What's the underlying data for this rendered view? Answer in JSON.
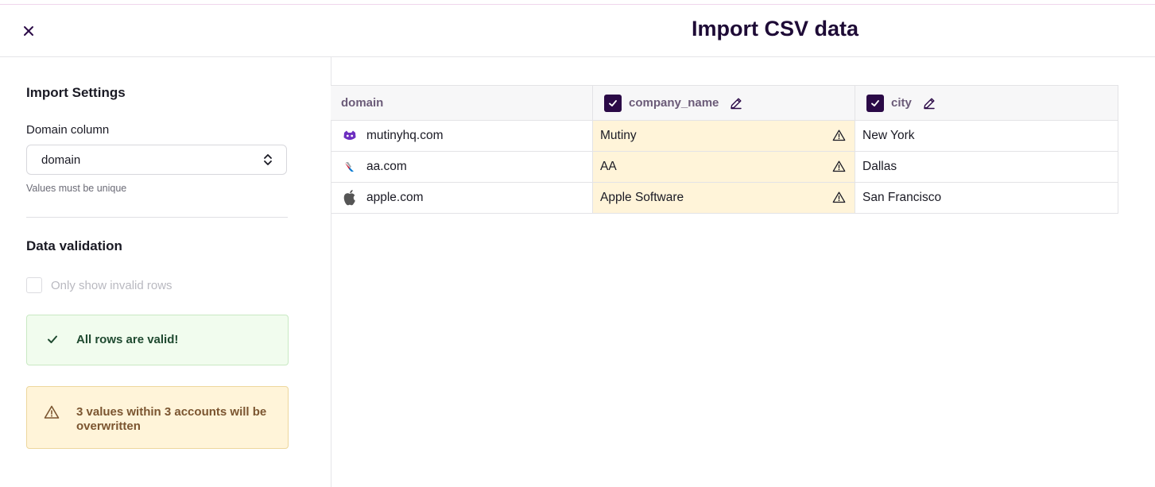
{
  "header": {
    "title": "Import CSV data"
  },
  "sidebar": {
    "settings_heading": "Import Settings",
    "domain_label": "Domain column",
    "domain_value": "domain",
    "domain_hint": "Values must be unique",
    "validation_heading": "Data validation",
    "invalid_only_label": "Only show invalid rows",
    "success_message": "All rows are valid!",
    "warning_message": "3 values within 3 accounts will be overwritten"
  },
  "table": {
    "columns": [
      "domain",
      "company_name",
      "city"
    ],
    "rows": [
      {
        "domain": "mutinyhq.com",
        "company_name": "Mutiny",
        "city": "New York"
      },
      {
        "domain": "aa.com",
        "company_name": "AA",
        "city": "Dallas"
      },
      {
        "domain": "apple.com",
        "company_name": "Apple Software",
        "city": "San Francisco"
      }
    ]
  },
  "colors": {
    "accent": "#2b0a47",
    "warning_bg": "#fff4d9",
    "success_bg": "#f1fcee"
  }
}
